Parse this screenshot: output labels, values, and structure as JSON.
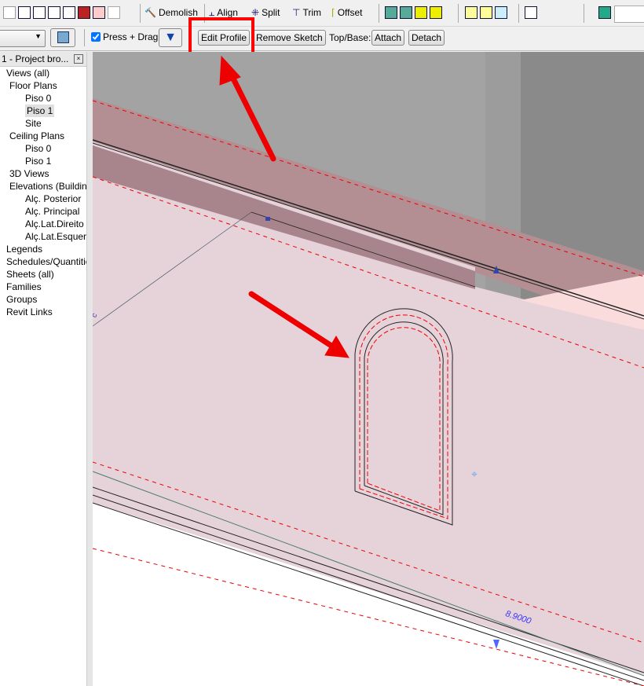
{
  "toolbar": {
    "demolish": "Demolish",
    "align": "Align",
    "split": "Split",
    "trim": "Trim",
    "offset": "Offset"
  },
  "options_bar": {
    "press_drag": "Press + Drag",
    "press_drag_checked": true,
    "edit_profile": "Edit Profile",
    "remove_sketch": "Remove Sketch",
    "top_base_label": "Top/Base:",
    "attach": "Attach",
    "detach": "Detach"
  },
  "browser": {
    "title": "1 - Project bro...",
    "items": [
      {
        "label": "Views (all)",
        "level": 0
      },
      {
        "label": "Floor Plans",
        "level": 1
      },
      {
        "label": "Piso 0",
        "level": 2
      },
      {
        "label": "Piso 1",
        "level": 2,
        "selected": true
      },
      {
        "label": "Site",
        "level": 2
      },
      {
        "label": "Ceiling Plans",
        "level": 1
      },
      {
        "label": "Piso 0",
        "level": 2
      },
      {
        "label": "Piso 1",
        "level": 2
      },
      {
        "label": "3D Views",
        "level": 1
      },
      {
        "label": "Elevations (Building",
        "level": 1
      },
      {
        "label": "Alç. Posterior",
        "level": 2
      },
      {
        "label": "Alç. Principal",
        "level": 2
      },
      {
        "label": "Alç.Lat.Direito",
        "level": 2
      },
      {
        "label": "Alç.Lat.Esquerd",
        "level": 2
      },
      {
        "label": "Legends",
        "level": 0
      },
      {
        "label": "Schedules/Quantitie",
        "level": 0
      },
      {
        "label": "Sheets (all)",
        "level": 0
      },
      {
        "label": "Families",
        "level": 0
      },
      {
        "label": "Groups",
        "level": 0
      },
      {
        "label": "Revit Links",
        "level": 0
      }
    ]
  },
  "viewport": {
    "dimension": "8.9000",
    "left_tag": "c"
  },
  "colors": {
    "highlight": "#ff0000",
    "wall_face": "#e6d3da",
    "wall_top": "#b38f93",
    "gray": "#a3a3a3"
  }
}
